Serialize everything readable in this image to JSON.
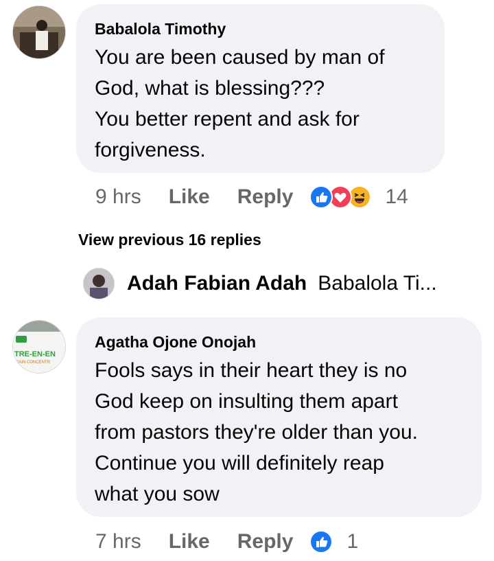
{
  "comments": [
    {
      "author": "Babalola Timothy",
      "lines": [
        "You  are been caused by man of",
        "God, what is blessing???",
        "You better repent and ask for",
        "forgiveness."
      ],
      "time": "9 hrs",
      "like_label": "Like",
      "reply_label": "Reply",
      "reactions": [
        "like-reaction-icon",
        "love-reaction-icon",
        "haha-reaction-icon"
      ],
      "reaction_count": "14"
    },
    {
      "author": "Agatha Ojone Onojah",
      "avatar_text": [
        "TRE-EN-EN",
        "RAIN CONCENTR"
      ],
      "lines": [
        "Fools says in their heart they is no",
        "God keep on insulting them apart",
        "from pastors they're older than you.",
        "Continue you will definitely reap",
        "what you sow"
      ],
      "time": "7 hrs",
      "like_label": "Like",
      "reply_label": "Reply",
      "reactions": [
        "like-reaction-icon"
      ],
      "reaction_count": "1"
    }
  ],
  "view_previous": "View previous 16 replies",
  "reply_preview": {
    "author": "Adah Fabian Adah",
    "text": "Babalola Ti..."
  },
  "colors": {
    "bubble": "#f0f2f5",
    "secondary_text": "#65676b",
    "like_blue": "#1877f2",
    "love_red": "#f33e58",
    "haha_yellow": "#f7b125"
  }
}
